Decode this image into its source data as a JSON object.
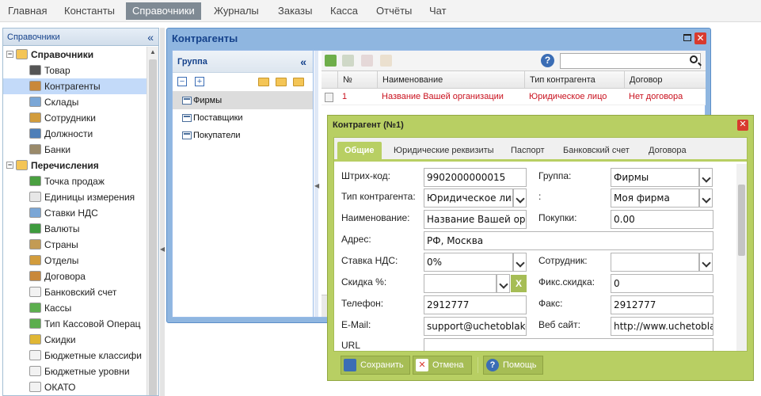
{
  "menu": [
    "Главная",
    "Константы",
    "Справочники",
    "Журналы",
    "Заказы",
    "Касса",
    "Отчёты",
    "Чат"
  ],
  "active_menu": "Справочники",
  "left_panel": {
    "title": "Справочники",
    "collapse_glyph": "«",
    "tree": [
      {
        "label": "Справочники",
        "level": 0,
        "bold": true,
        "expander": "−",
        "icon": "folder-icon"
      },
      {
        "label": "Товар",
        "level": 1,
        "icon": "barcode-icon"
      },
      {
        "label": "Контрагенты",
        "level": 1,
        "icon": "contractors-icon",
        "selected": true
      },
      {
        "label": "Склады",
        "level": 1,
        "icon": "warehouse-icon"
      },
      {
        "label": "Сотрудники",
        "level": 1,
        "icon": "employees-icon"
      },
      {
        "label": "Должности",
        "level": 1,
        "icon": "position-icon"
      },
      {
        "label": "Банки",
        "level": 1,
        "icon": "bank-icon"
      },
      {
        "label": "Перечисления",
        "level": 0,
        "bold": true,
        "expander": "−",
        "icon": "folder-icon"
      },
      {
        "label": "Точка продаж",
        "level": 1,
        "icon": "cash-register-icon"
      },
      {
        "label": "Единицы измерения",
        "level": 1,
        "icon": "unit-icon"
      },
      {
        "label": "Ставки НДС",
        "level": 1,
        "icon": "percent-icon"
      },
      {
        "label": "Валюты",
        "level": 1,
        "icon": "dollar-icon"
      },
      {
        "label": "Страны",
        "level": 1,
        "icon": "signpost-icon"
      },
      {
        "label": "Отделы",
        "level": 1,
        "icon": "department-icon"
      },
      {
        "label": "Договора",
        "level": 1,
        "icon": "contract-icon"
      },
      {
        "label": "Банковский счет",
        "level": 1,
        "icon": "document-icon"
      },
      {
        "label": "Кассы",
        "level": 1,
        "icon": "money-icon"
      },
      {
        "label": "Тип Кассовой Операц",
        "level": 1,
        "icon": "money-icon"
      },
      {
        "label": "Скидки",
        "level": 1,
        "icon": "discount-icon"
      },
      {
        "label": "Бюджетные классифи",
        "level": 1,
        "icon": "document-icon"
      },
      {
        "label": "Бюджетные уровни",
        "level": 1,
        "icon": "document-icon"
      },
      {
        "label": "ОКАТО",
        "level": 1,
        "icon": "document-icon"
      }
    ]
  },
  "window": {
    "title": "Контрагенты",
    "group_panel": {
      "title": "Группа",
      "collapse_glyph": "«",
      "collapse_all": "−",
      "expand_all": "+",
      "items": [
        {
          "label": "Фирмы",
          "selected": true
        },
        {
          "label": "Поставщики"
        },
        {
          "label": "Покупатели"
        }
      ]
    },
    "grid": {
      "columns": [
        "№",
        "Наименование",
        "Тип контрагента",
        "Договор"
      ],
      "rows": [
        {
          "num": "1",
          "name": "Название Вашей организации",
          "type": "Юридическое лицо",
          "contract": "Нет договора"
        }
      ],
      "search_value": "",
      "help_glyph": "?"
    }
  },
  "dialog": {
    "title": "Контрагент (№1)",
    "close_glyph": "✕",
    "tabs": [
      "Общие",
      "Юридические реквизиты",
      "Паспорт",
      "Банковский счет",
      "Договора"
    ],
    "active_tab": "Общие",
    "fields": {
      "barcode": {
        "label": "Штрих-код:",
        "value": "9902000000015"
      },
      "group": {
        "label": "Группа:",
        "value": "Фирмы"
      },
      "type": {
        "label": "Тип контрагента:",
        "value": "Юридическое лицо"
      },
      "colon": {
        "label": ":",
        "value": "Моя фирма"
      },
      "name": {
        "label": "Наименование:",
        "value": "Название Вашей организации"
      },
      "purchases": {
        "label": "Покупки:",
        "value": "0.00"
      },
      "address": {
        "label": "Адрес:",
        "value": "РФ, Москва"
      },
      "vat": {
        "label": "Ставка НДС:",
        "value": "0%"
      },
      "employee": {
        "label": "Сотрудник:",
        "value": ""
      },
      "discount": {
        "label": "Скидка %:",
        "value": "",
        "clear_glyph": "X"
      },
      "fixed_discount": {
        "label": "Фикс.скидка:",
        "value": "0"
      },
      "phone": {
        "label": "Телефон:",
        "value": "2912777"
      },
      "fax": {
        "label": "Факс:",
        "value": "2912777"
      },
      "email": {
        "label": "E-Mail:",
        "value": "support@uchetoblako.ru"
      },
      "website": {
        "label": "Веб сайт:",
        "value": "http://www.uchetoblako.ru"
      },
      "url": {
        "label": "URL",
        "value": ""
      }
    },
    "buttons": {
      "save": "Сохранить",
      "cancel": "Отмена",
      "help": "Помощь"
    }
  },
  "colors": {
    "accent_blue": "#8fb6e0",
    "dialog_green": "#b8cf63",
    "button_green": "#a6bd55",
    "row_red": "#c9111e",
    "menu_active": "#7f8a94"
  }
}
